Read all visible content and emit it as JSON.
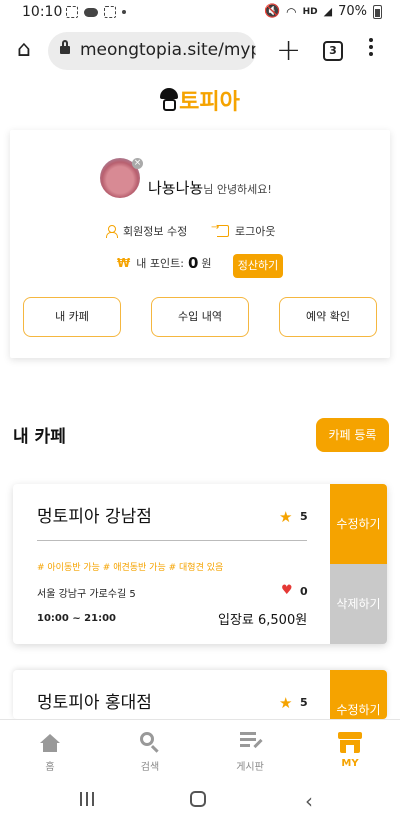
{
  "status_bar": {
    "time": "10:10",
    "network": "HD",
    "battery": "70%"
  },
  "browser": {
    "url": "meongtopia.site/mypa",
    "tab_count": "3"
  },
  "brand": {
    "logo_text": "토피아",
    "accent_color": "#f5a300"
  },
  "profile": {
    "nickname": "나뇽나뇽",
    "greeting_suffix": "님 안녕하세요!",
    "edit_label": "회원정보 수정",
    "logout_label": "로그아웃",
    "points_label": "내 포인트:",
    "points_value": "0",
    "points_unit": "원",
    "settle_label": "정산하기",
    "tabs": [
      "내 카페",
      "수입 내역",
      "예약 확인"
    ]
  },
  "my_cafe": {
    "title": "내 카페",
    "register_label": "카페 등록",
    "cafes": [
      {
        "name": "멍토피아 강남점",
        "rating": "5",
        "tags": "# 아이동반 가능  # 애견동반 가능  # 대형견 있음",
        "address": "서울 강남구 가로수길 5",
        "likes": "0",
        "hours": "10:00 ~ 21:00",
        "fee": "입장료 6,500원",
        "edit_label": "수정하기",
        "delete_label": "삭제하기"
      },
      {
        "name": "멍토피아 홍대점",
        "rating": "5",
        "edit_label": "수정하기"
      }
    ]
  },
  "bottom_nav": [
    {
      "label": "홈",
      "icon": "home-icon"
    },
    {
      "label": "검색",
      "icon": "search-icon"
    },
    {
      "label": "게시판",
      "icon": "board-icon"
    },
    {
      "label": "MY",
      "icon": "store-icon",
      "active": true
    }
  ]
}
